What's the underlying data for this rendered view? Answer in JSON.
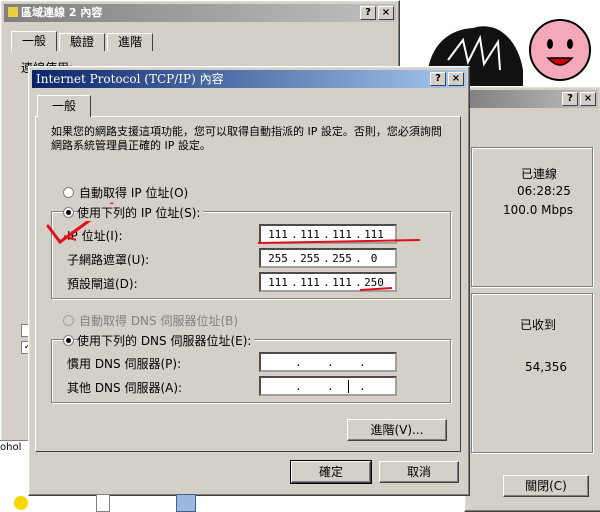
{
  "back_window": {
    "title": "區域連線 2 內容",
    "tabs": [
      "一般",
      "驗證",
      "進階"
    ],
    "partial_text": "連線使用:"
  },
  "status_window": {
    "status_value": "已連線",
    "duration_value": "06:28:25",
    "speed_value": "100.0 Mbps",
    "received_label": "已收到",
    "received_bytes": "54,356",
    "close_button": "關閉(C)"
  },
  "dialog": {
    "title": "Internet Protocol (TCP/IP) 內容",
    "help_btn": "?",
    "close_btn": "×",
    "tab": "一般",
    "description": "如果您的網路支援這項功能，您可以取得自動指派的 IP 設定。否則，您必須詢問網路系統管理員正確的 IP 設定。",
    "radio_auto_ip": "自動取得 IP 位址(O)",
    "radio_manual_ip": "使用下列的 IP 位址(S):",
    "ip_label": "IP 位址(I):",
    "ip_value": [
      "111",
      "111",
      "111",
      "111"
    ],
    "mask_label": "子網路遮罩(U):",
    "mask_value": [
      "255",
      "255",
      "255",
      "0"
    ],
    "gateway_label": "預設閘道(D):",
    "gateway_value": [
      "111",
      "111",
      "111",
      "250"
    ],
    "radio_auto_dns": "自動取得 DNS 伺服器位址(B)",
    "radio_manual_dns": "使用下列的 DNS 伺服器位址(E):",
    "pref_dns_label": "慣用 DNS 伺服器(P):",
    "alt_dns_label": "其他 DNS 伺服器(A):",
    "advanced_button": "進階(V)...",
    "ok_button": "確定",
    "cancel_button": "取消"
  },
  "taskbar": {
    "partial_label": "ohol"
  },
  "accent": {
    "title_active": "#0a246a",
    "title_inactive": "#808080",
    "red_annotation": "#e0101a"
  }
}
